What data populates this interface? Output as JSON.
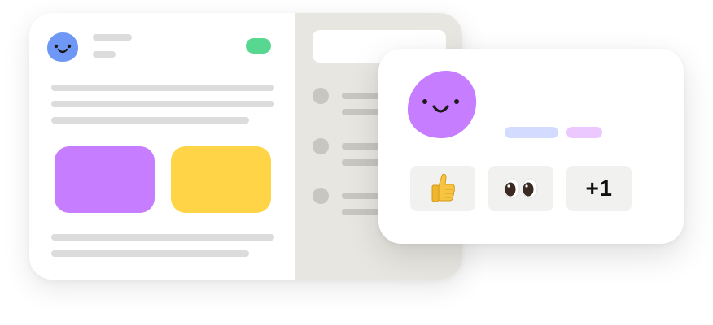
{
  "colors": {
    "card_background": "#ffffff",
    "panel_background": "#e8e6e0",
    "avatar_small": "#6f97f5",
    "avatar_big": "#c77dff",
    "status_pill": "#57d78f",
    "tile_purple": "#c77dff",
    "tile_yellow": "#ffd447",
    "tag_blue": "#d3dcff",
    "tag_lilac": "#ebc8ff",
    "reaction_background": "#f1f1ef"
  },
  "reactions": {
    "thumbs_up_icon": "thumbs-up-emoji",
    "eyes_icon": "eyes-emoji",
    "more_label": "+1"
  }
}
